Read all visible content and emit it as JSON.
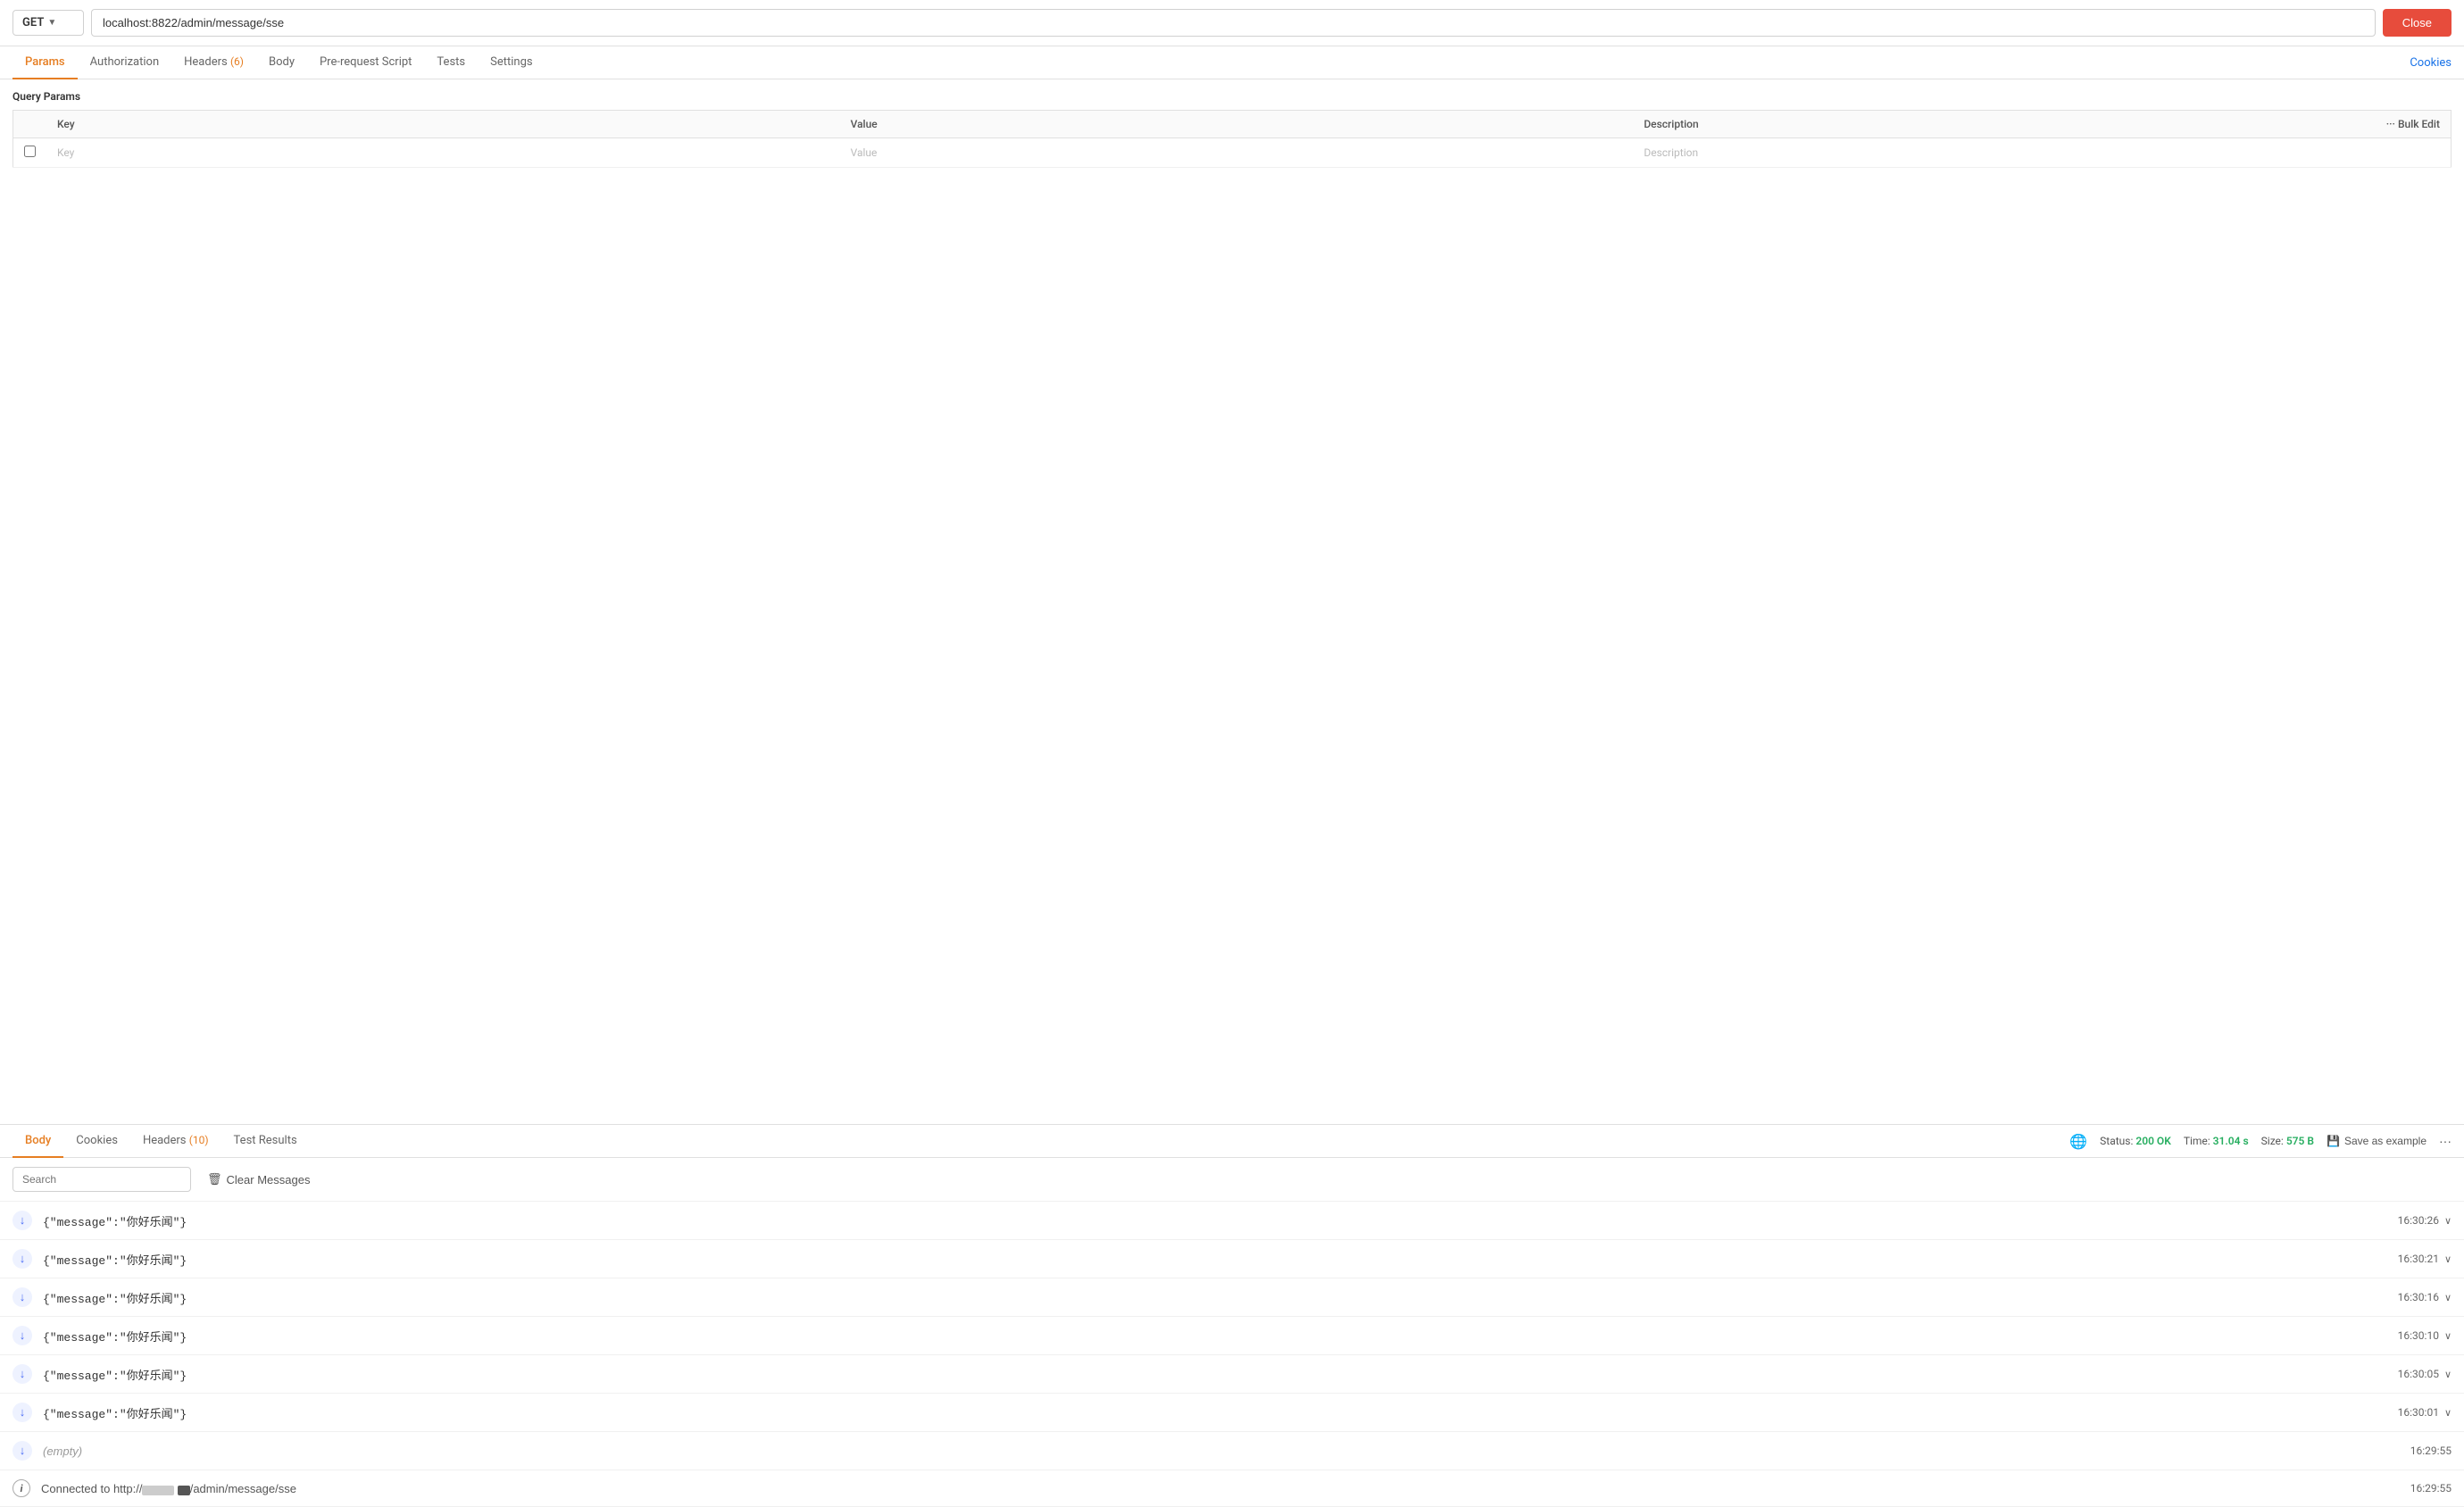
{
  "urlBar": {
    "method": "GET",
    "url": "localhost:8822/admin/message/sse",
    "closeLabel": "Close"
  },
  "requestTabs": [
    {
      "id": "params",
      "label": "Params",
      "active": true,
      "badge": null
    },
    {
      "id": "authorization",
      "label": "Authorization",
      "active": false,
      "badge": null
    },
    {
      "id": "headers",
      "label": "Headers",
      "active": false,
      "badge": "6"
    },
    {
      "id": "body",
      "label": "Body",
      "active": false,
      "badge": null
    },
    {
      "id": "prerequest",
      "label": "Pre-request Script",
      "active": false,
      "badge": null
    },
    {
      "id": "tests",
      "label": "Tests",
      "active": false,
      "badge": null
    },
    {
      "id": "settings",
      "label": "Settings",
      "active": false,
      "badge": null
    }
  ],
  "cookiesLink": "Cookies",
  "queryParams": {
    "title": "Query Params",
    "columns": [
      "Key",
      "Value",
      "Description"
    ],
    "bulkEdit": "Bulk Edit",
    "placeholder": {
      "key": "Key",
      "value": "Value",
      "description": "Description"
    }
  },
  "responseTabs": [
    {
      "id": "body",
      "label": "Body",
      "active": true,
      "badge": null
    },
    {
      "id": "cookies",
      "label": "Cookies",
      "active": false,
      "badge": null
    },
    {
      "id": "headers",
      "label": "Headers",
      "active": false,
      "badge": "10"
    },
    {
      "id": "testresults",
      "label": "Test Results",
      "active": false,
      "badge": null
    }
  ],
  "responseMeta": {
    "statusLabel": "Status:",
    "statusValue": "200 OK",
    "timeLabel": "Time:",
    "timeValue": "31.04 s",
    "sizeLabel": "Size:",
    "sizeValue": "575 B"
  },
  "saveExample": "Save as example",
  "toolbar": {
    "searchPlaceholder": "Search",
    "clearMessages": "Clear Messages"
  },
  "messages": [
    {
      "type": "arrow",
      "content": "{\"message\":\"你好乐闻\"}",
      "time": "16:30:26"
    },
    {
      "type": "arrow",
      "content": "{\"message\":\"你好乐闻\"}",
      "time": "16:30:21"
    },
    {
      "type": "arrow",
      "content": "{\"message\":\"你好乐闻\"}",
      "time": "16:30:16"
    },
    {
      "type": "arrow",
      "content": "{\"message\":\"你好乐闻\"}",
      "time": "16:30:10"
    },
    {
      "type": "arrow",
      "content": "{\"message\":\"你好乐闻\"}",
      "time": "16:30:05"
    },
    {
      "type": "arrow",
      "content": "{\"message\":\"你好乐闻\"}",
      "time": "16:30:01"
    },
    {
      "type": "arrow",
      "content": "(empty)",
      "time": "16:29:55",
      "empty": true
    },
    {
      "type": "info",
      "content": "Connected to http://localhost:8822/admin/message/sse",
      "time": "16:29:55",
      "truncated": true
    }
  ]
}
